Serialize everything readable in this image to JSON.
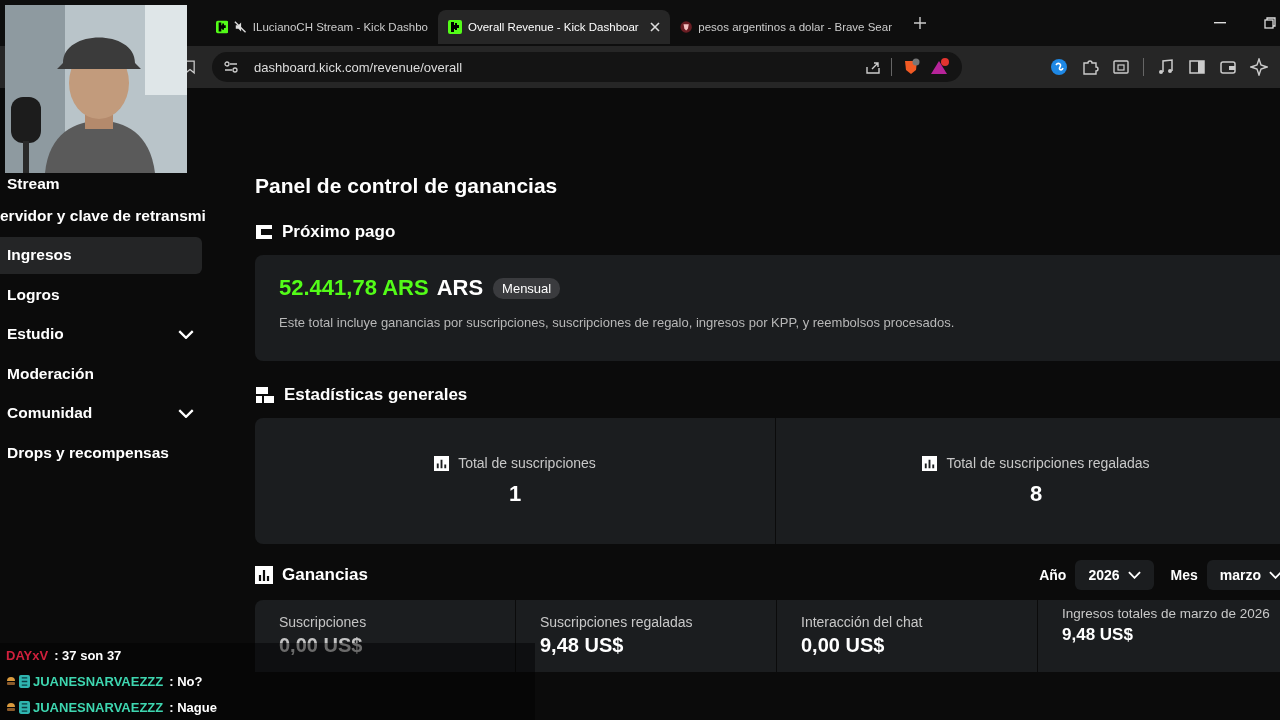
{
  "browser": {
    "tabs": [
      {
        "title": "ILucianoCH Stream - Kick Dashbo",
        "selected": false,
        "muted": true
      },
      {
        "title": "Overall Revenue - Kick Dashboar",
        "selected": true,
        "muted": false
      },
      {
        "title": "pesos argentinos a dolar - Brave Sear",
        "selected": false,
        "muted": false
      }
    ],
    "address": "dashboard.kick.com/revenue/overall"
  },
  "sidebar": {
    "items": [
      {
        "label": "Stream",
        "selected": false
      },
      {
        "label": "ervidor y clave de retransmi",
        "selected": false
      },
      {
        "label": "Ingresos",
        "selected": true
      },
      {
        "label": "Logros",
        "selected": false
      },
      {
        "label": "Estudio",
        "selected": false,
        "expanded": false
      },
      {
        "label": "Moderación",
        "selected": false
      },
      {
        "label": "Comunidad",
        "selected": false,
        "expanded": false
      },
      {
        "label": "Drops y recompensas",
        "selected": false
      }
    ]
  },
  "page": {
    "title": "Panel de control de ganancias",
    "next_payment": {
      "heading": "Próximo pago",
      "amount": "52.441,78 ARS",
      "currency": "ARS",
      "badge": "Mensual",
      "note": "Este total incluye ganancias por suscripciones, suscripciones de regalo, ingresos por KPP, y reembolsos procesados."
    },
    "stats": {
      "heading": "Estadísticas generales",
      "items": [
        {
          "label": "Total de suscripciones",
          "value": "1"
        },
        {
          "label": "Total de suscripciones regaladas",
          "value": "8"
        }
      ]
    },
    "earnings": {
      "heading": "Ganancias",
      "year_label": "Año",
      "year": "2026",
      "month_label": "Mes",
      "month": "marzo",
      "cards": [
        {
          "label": "Suscripciones",
          "value": "0,00 US$"
        },
        {
          "label": "Suscripciones regaladas",
          "value": "9,48 US$"
        },
        {
          "label": "Interacción del chat",
          "value": "0,00 US$"
        },
        {
          "label": "Ingresos totales de marzo de 2026",
          "value": "9,48 US$"
        }
      ]
    }
  },
  "chat": [
    {
      "user": "DAYxV",
      "message": ": 37 son 37",
      "color": "#d0203c",
      "badges": false
    },
    {
      "user": "JUANESNARVAEZZZ",
      "message": ": No?",
      "color": "#3ed6b0",
      "badges": true
    },
    {
      "user": "JUANESNARVAEZZZ",
      "message": ": Nague",
      "color": "#3ed6b0",
      "badges": true
    }
  ]
}
